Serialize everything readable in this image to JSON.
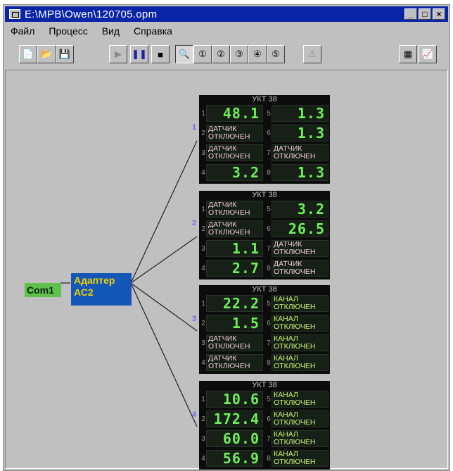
{
  "window": {
    "title": "E:\\MPB\\Owen\\120705.opm",
    "buttons": {
      "minimize": "_",
      "maximize": "□",
      "close": "×"
    }
  },
  "menu": [
    "Файл",
    "Процесс",
    "Вид",
    "Справка"
  ],
  "toolbar": {
    "buttons": [
      {
        "name": "new-file-button",
        "icon": "📄"
      },
      {
        "name": "open-file-button",
        "icon": "📂"
      },
      {
        "name": "save-button",
        "icon": "💾"
      },
      {
        "name": "play-button",
        "icon": "▶"
      },
      {
        "name": "pause-button",
        "icon": "❚❚"
      },
      {
        "name": "stop-button",
        "icon": "■"
      },
      {
        "name": "zoom-button",
        "icon": "🔍"
      },
      {
        "name": "device-1-button",
        "icon": "①"
      },
      {
        "name": "device-2-button",
        "icon": "②"
      },
      {
        "name": "device-3-button",
        "icon": "③"
      },
      {
        "name": "device-4-button",
        "icon": "④"
      },
      {
        "name": "device-5-button",
        "icon": "⑤"
      },
      {
        "name": "info-button",
        "icon": "⚠"
      },
      {
        "name": "table-button",
        "icon": "▦"
      },
      {
        "name": "chart-button",
        "icon": "📈"
      }
    ]
  },
  "diagram": {
    "com_port": "Com1",
    "adapter": {
      "line1": "Адаптер",
      "line2": "АС2"
    },
    "devices": [
      {
        "index": "1",
        "title": "УКТ 38",
        "channels": [
          {
            "n": "1",
            "type": "value",
            "text": "48.1"
          },
          {
            "n": "5",
            "type": "value",
            "text": "1.3"
          },
          {
            "n": "2",
            "type": "status",
            "text": "ДАТЧИК ОТКЛЮЧЕН"
          },
          {
            "n": "6",
            "type": "value",
            "text": "1.3"
          },
          {
            "n": "3",
            "type": "status",
            "text": "ДАТЧИК ОТКЛЮЧЕН"
          },
          {
            "n": "7",
            "type": "status",
            "text": "ДАТЧИК ОТКЛЮЧЕН"
          },
          {
            "n": "4",
            "type": "value",
            "text": "3.2"
          },
          {
            "n": "8",
            "type": "value",
            "text": "1.3"
          }
        ]
      },
      {
        "index": "2",
        "title": "УКТ 38",
        "channels": [
          {
            "n": "1",
            "type": "status",
            "text": "ДАТЧИК ОТКЛЮЧЕН"
          },
          {
            "n": "5",
            "type": "value",
            "text": "3.2"
          },
          {
            "n": "2",
            "type": "status",
            "text": "ДАТЧИК ОТКЛЮЧЕН"
          },
          {
            "n": "6",
            "type": "value",
            "text": "26.5"
          },
          {
            "n": "3",
            "type": "value",
            "text": "1.1"
          },
          {
            "n": "7",
            "type": "status",
            "text": "ДАТЧИК ОТКЛЮЧЕН"
          },
          {
            "n": "4",
            "type": "value",
            "text": "2.7"
          },
          {
            "n": "8",
            "type": "status",
            "text": "ДАТЧИК ОТКЛЮЧЕН"
          }
        ]
      },
      {
        "index": "3",
        "title": "УКТ 38",
        "channels": [
          {
            "n": "1",
            "type": "value",
            "text": "22.2"
          },
          {
            "n": "5",
            "type": "off",
            "text": "КАНАЛ ОТКЛЮЧЕН"
          },
          {
            "n": "2",
            "type": "value",
            "text": "1.5"
          },
          {
            "n": "6",
            "type": "off",
            "text": "КАНАЛ ОТКЛЮЧЕН"
          },
          {
            "n": "3",
            "type": "status",
            "text": "ДАТЧИК ОТКЛЮЧЕН"
          },
          {
            "n": "7",
            "type": "off",
            "text": "КАНАЛ ОТКЛЮЧЕН"
          },
          {
            "n": "4",
            "type": "status",
            "text": "ДАТЧИК ОТКЛЮЧЕН"
          },
          {
            "n": "8",
            "type": "off",
            "text": "КАНАЛ ОТКЛЮЧЕН"
          }
        ]
      },
      {
        "index": "4",
        "title": "УКТ 38",
        "channels": [
          {
            "n": "1",
            "type": "value",
            "text": "10.6"
          },
          {
            "n": "5",
            "type": "off",
            "text": "КАНАЛ ОТКЛЮЧЕН"
          },
          {
            "n": "2",
            "type": "value",
            "text": "172.4"
          },
          {
            "n": "6",
            "type": "off",
            "text": "КАНАЛ ОТКЛЮЧЕН"
          },
          {
            "n": "3",
            "type": "value",
            "text": "60.0"
          },
          {
            "n": "7",
            "type": "off",
            "text": "КАНАЛ ОТКЛЮЧЕН"
          },
          {
            "n": "4",
            "type": "value",
            "text": "56.9"
          },
          {
            "n": "8",
            "type": "off",
            "text": "КАНАЛ ОТКЛЮЧЕН"
          }
        ]
      }
    ]
  },
  "colors": {
    "title_bar": "#0a24a8",
    "com_port": "#5ec24a",
    "adapter_bg": "#1457b8",
    "adapter_text": "#f0d000",
    "digit": "#6ef05a"
  }
}
